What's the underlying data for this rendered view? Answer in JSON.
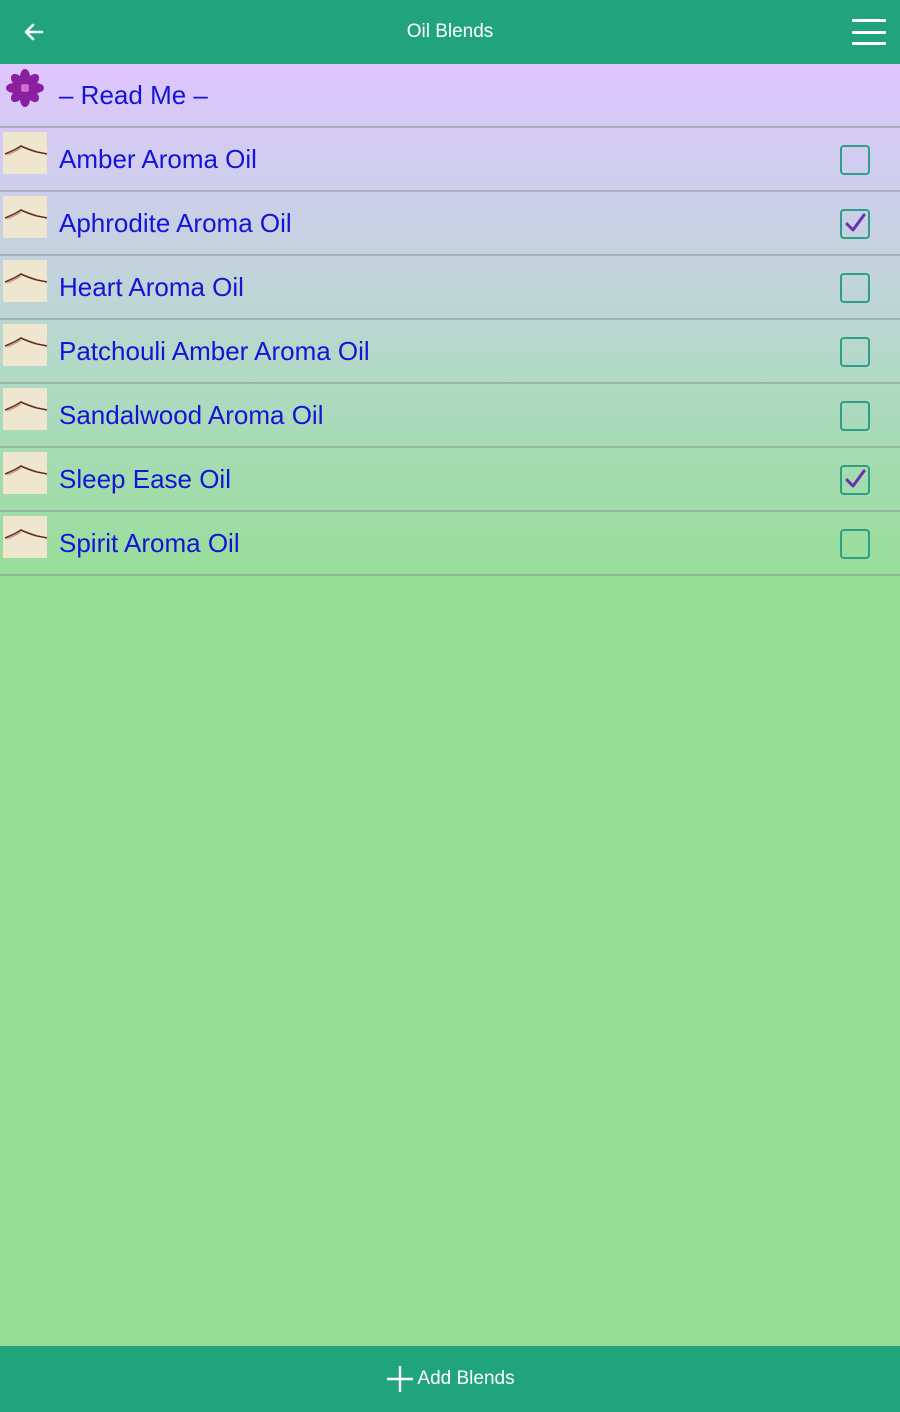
{
  "header": {
    "title": "Oil Blends",
    "back_icon": "back-arrow-icon",
    "menu_icon": "hamburger-menu-icon"
  },
  "list": {
    "readme": {
      "label": "– Read Me –",
      "icon": "flower-icon"
    },
    "items": [
      {
        "label": "Amber Aroma Oil",
        "checked": false
      },
      {
        "label": "Aphrodite Aroma Oil",
        "checked": true
      },
      {
        "label": "Heart Aroma Oil",
        "checked": false
      },
      {
        "label": "Patchouli Amber Aroma Oil",
        "checked": false
      },
      {
        "label": "Sandalwood Aroma Oil",
        "checked": false
      },
      {
        "label": "Sleep Ease Oil",
        "checked": true
      },
      {
        "label": "Spirit Aroma Oil",
        "checked": false
      }
    ]
  },
  "footer": {
    "add_label": "Add Blends",
    "add_icon": "plus-icon"
  },
  "colors": {
    "header": "#21a47c",
    "text": "#1414d6",
    "check": "#6a2fb0",
    "checkbox_border": "#2f9e88",
    "background": "#97dd97"
  }
}
